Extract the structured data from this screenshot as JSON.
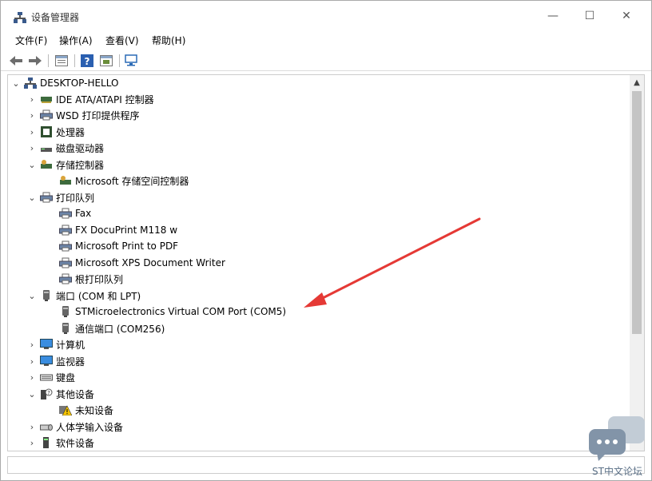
{
  "window": {
    "title": "设备管理器",
    "controls": {
      "minimize": "—",
      "maximize": "☐",
      "close": "✕"
    }
  },
  "menu": [
    {
      "label": "文件(F)"
    },
    {
      "label": "操作(A)"
    },
    {
      "label": "查看(V)"
    },
    {
      "label": "帮助(H)"
    }
  ],
  "toolbar": {
    "buttons": [
      "back-icon",
      "forward-icon",
      "properties-icon",
      "help-icon",
      "update-driver-icon",
      "scan-hardware-icon"
    ]
  },
  "tree": {
    "root": "DESKTOP-HELLO",
    "items": [
      {
        "label": "IDE ATA/ATAPI 控制器",
        "state": "collapsed",
        "icon": "ide-controller-icon"
      },
      {
        "label": "WSD 打印提供程序",
        "state": "collapsed",
        "icon": "printer-icon"
      },
      {
        "label": "处理器",
        "state": "collapsed",
        "icon": "processor-icon"
      },
      {
        "label": "磁盘驱动器",
        "state": "collapsed",
        "icon": "disk-drive-icon"
      },
      {
        "label": "存储控制器",
        "state": "expanded",
        "icon": "storage-controller-icon"
      },
      {
        "label": "Microsoft 存储空间控制器",
        "state": "leaf",
        "icon": "storage-controller-icon"
      },
      {
        "label": "打印队列",
        "state": "expanded",
        "icon": "printer-icon"
      },
      {
        "label": "Fax",
        "state": "leaf",
        "icon": "printer-icon"
      },
      {
        "label": "FX DocuPrint M118 w",
        "state": "leaf",
        "icon": "printer-icon"
      },
      {
        "label": "Microsoft Print to PDF",
        "state": "leaf",
        "icon": "printer-icon"
      },
      {
        "label": "Microsoft XPS Document Writer",
        "state": "leaf",
        "icon": "printer-icon"
      },
      {
        "label": "根打印队列",
        "state": "leaf",
        "icon": "printer-icon"
      },
      {
        "label": "端口 (COM 和 LPT)",
        "state": "expanded",
        "icon": "port-icon"
      },
      {
        "label": "STMicroelectronics Virtual COM Port (COM5)",
        "state": "leaf",
        "icon": "port-icon"
      },
      {
        "label": "通信端口 (COM256)",
        "state": "leaf",
        "icon": "port-icon"
      },
      {
        "label": "计算机",
        "state": "collapsed",
        "icon": "computer-icon"
      },
      {
        "label": "监视器",
        "state": "collapsed",
        "icon": "monitor-icon"
      },
      {
        "label": "键盘",
        "state": "collapsed",
        "icon": "keyboard-icon"
      },
      {
        "label": "其他设备",
        "state": "expanded",
        "icon": "other-devices-icon"
      },
      {
        "label": "未知设备",
        "state": "leaf",
        "icon": "unknown-device-warning-icon"
      },
      {
        "label": "人体学输入设备",
        "state": "collapsed",
        "icon": "hid-icon"
      },
      {
        "label": "软件设备",
        "state": "collapsed",
        "icon": "software-device-icon"
      }
    ]
  },
  "watermark": {
    "text": "ST中文论坛"
  },
  "colors": {
    "annotation_arrow": "#e53935",
    "selection_blue": "#0078d7"
  }
}
